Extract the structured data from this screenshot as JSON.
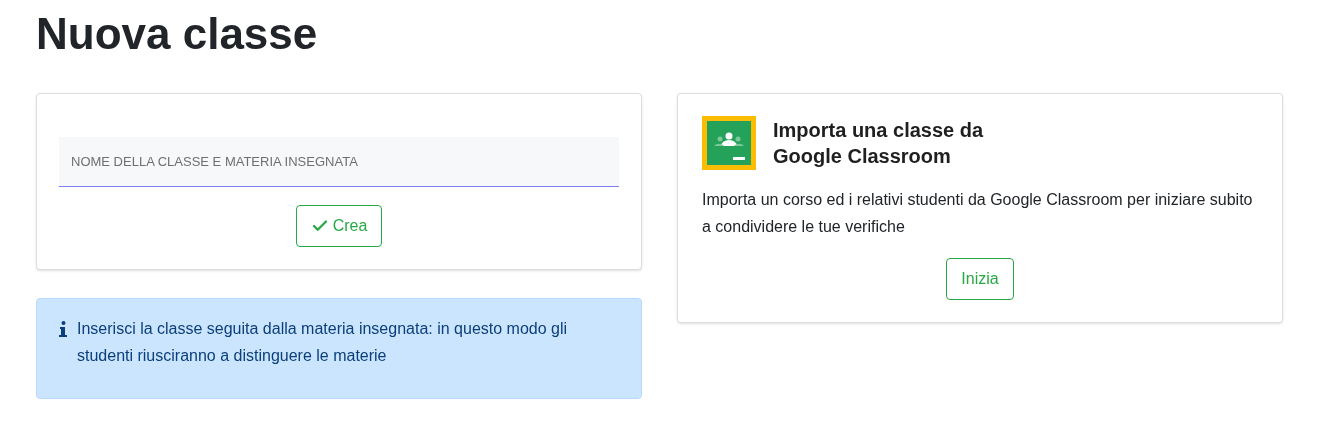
{
  "page_title": "Nuova classe",
  "create_form": {
    "name_field": {
      "placeholder": "NOME DELLA CLASSE E MATERIA INSEGNATA"
    },
    "create_button": "Crea"
  },
  "info_alert": {
    "text": "Inserisci la classe seguita dalla materia insegnata: in questo modo gli studenti riusciranno a distinguere le materie"
  },
  "import_card": {
    "title_lines": [
      "Importa una classe da",
      "Google Classroom"
    ],
    "description": "Importa un corso ed i relativi studenti da Google Classroom per iniziare subito a condividere le tue verifiche",
    "start_button": "Inizia"
  }
}
